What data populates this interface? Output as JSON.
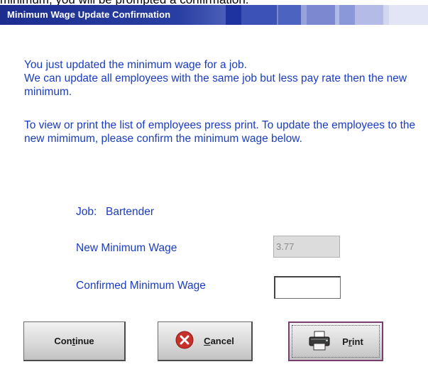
{
  "cutoff_text": "minimum, you will be prompted a confirmation.",
  "window": {
    "title": "Minimum Wage Update Confirmation"
  },
  "message": {
    "line1": "You just updated the minimum wage for a job.",
    "line2": "We can update all employees with the same job but less pay rate then the new minimum.",
    "line3": "To view or print the list of employees press print. To update the employees to the new mimimum, please confirm the minimum wage below."
  },
  "job": {
    "label": "Job:",
    "value": "Bartender"
  },
  "new_min_wage": {
    "label": "New Minimum Wage",
    "value": "3.77"
  },
  "confirmed_min_wage": {
    "label": "Confirmed Minimum Wage",
    "value": ""
  },
  "buttons": {
    "continue": {
      "pre": "Con",
      "accel": "t",
      "post": "inue"
    },
    "cancel": {
      "pre": "",
      "accel": "C",
      "post": "ancel"
    },
    "print": {
      "pre": "P",
      "accel": "r",
      "post": "int"
    }
  },
  "icons": {
    "cancel": "cancel-x-icon",
    "print": "printer-icon"
  },
  "colors": {
    "text": "#1a3cc0",
    "title_bar": "#1c2d8f",
    "cancel_icon": "#c8302a"
  }
}
